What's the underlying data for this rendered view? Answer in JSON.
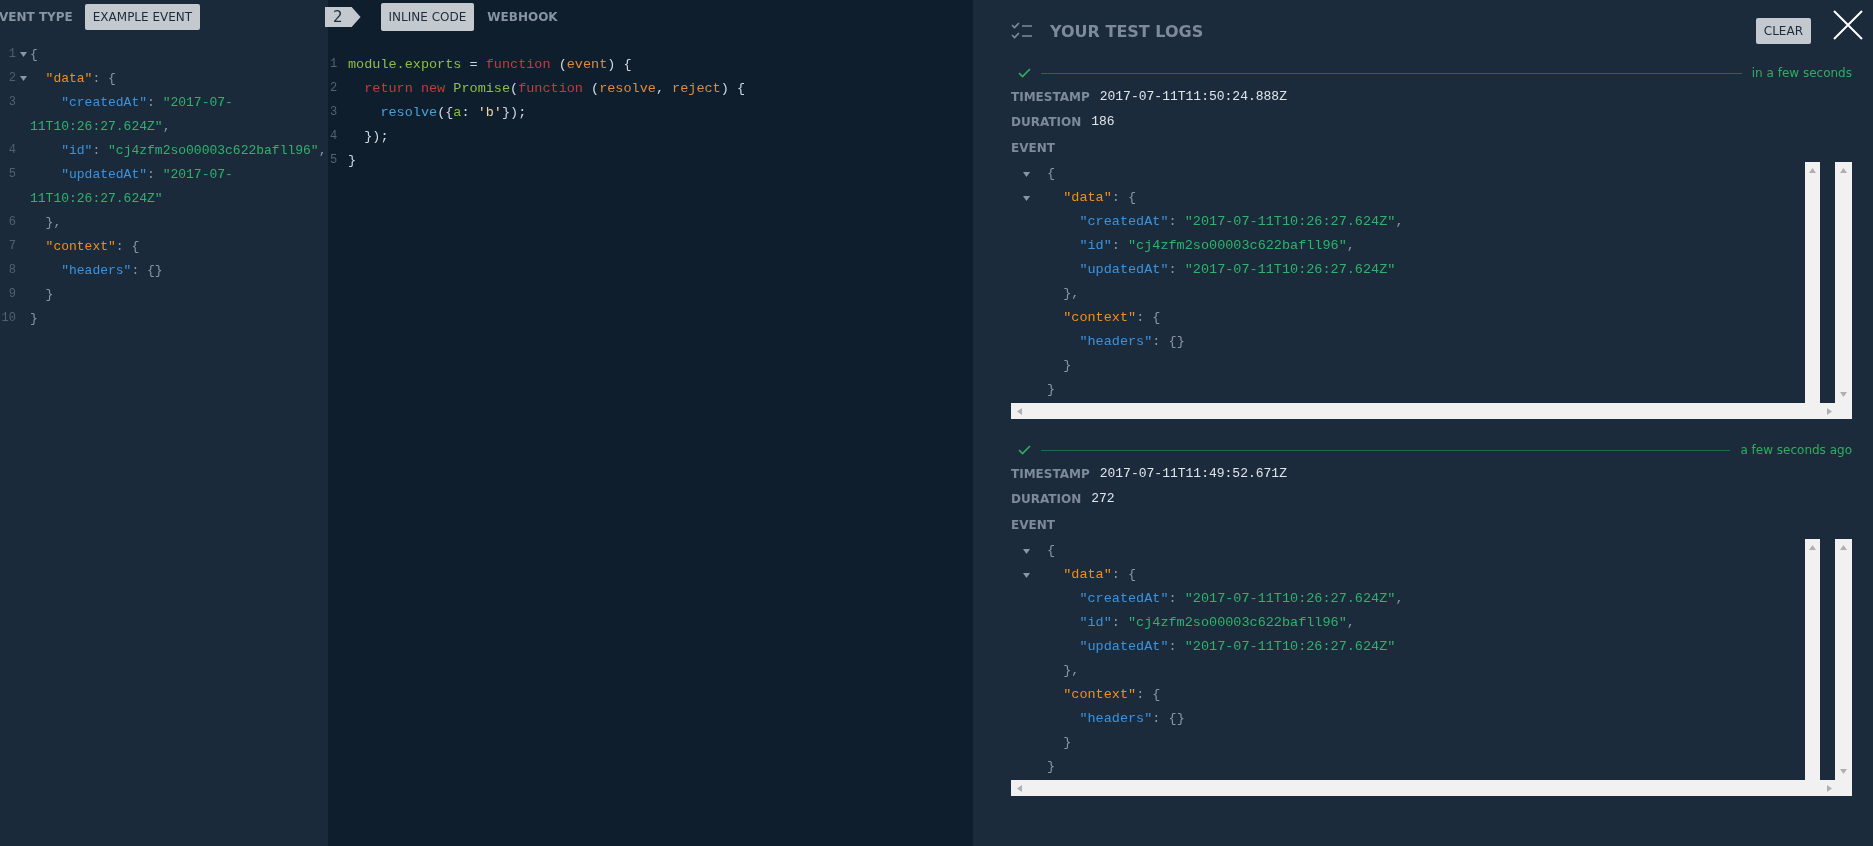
{
  "event_panel": {
    "label": "VENT TYPE",
    "button": "EXAMPLE EVENT",
    "lines": [
      {
        "n": "1",
        "fold": true,
        "tokens": [
          {
            "kind": "p",
            "text": "{"
          }
        ]
      },
      {
        "n": "2",
        "fold": true,
        "tokens": [
          {
            "kind": "prop",
            "text": "  \"data\""
          },
          {
            "kind": "p",
            "text": ": {"
          }
        ]
      },
      {
        "n": "3",
        "fold": false,
        "tokens": [
          {
            "kind": "key",
            "text": "    \"createdAt\""
          },
          {
            "kind": "p",
            "text": ": "
          },
          {
            "kind": "str",
            "text": "\"2017-07-"
          }
        ]
      },
      {
        "fold": false,
        "tokens": [
          {
            "kind": "str",
            "text": "11T10:26:27.624Z\""
          },
          {
            "kind": "p",
            "text": ","
          }
        ]
      },
      {
        "n": "4",
        "fold": false,
        "tokens": [
          {
            "kind": "key",
            "text": "    \"id\""
          },
          {
            "kind": "p",
            "text": ": "
          },
          {
            "kind": "str",
            "text": "\"cj4zfm2so00003c622bafll96\""
          },
          {
            "kind": "p",
            "text": ","
          }
        ]
      },
      {
        "n": "5",
        "fold": false,
        "tokens": [
          {
            "kind": "key",
            "text": "    \"updatedAt\""
          },
          {
            "kind": "p",
            "text": ": "
          },
          {
            "kind": "str",
            "text": "\"2017-07-"
          }
        ]
      },
      {
        "fold": false,
        "tokens": [
          {
            "kind": "str",
            "text": "11T10:26:27.624Z\""
          }
        ]
      },
      {
        "n": "6",
        "fold": false,
        "tokens": [
          {
            "kind": "p",
            "text": "  },"
          }
        ]
      },
      {
        "n": "7",
        "fold": false,
        "tokens": [
          {
            "kind": "prop",
            "text": "  \"context\""
          },
          {
            "kind": "p",
            "text": ": {"
          }
        ]
      },
      {
        "n": "8",
        "fold": false,
        "tokens": [
          {
            "kind": "key",
            "text": "    \"headers\""
          },
          {
            "kind": "p",
            "text": ": {}"
          }
        ]
      },
      {
        "n": "9",
        "fold": false,
        "tokens": [
          {
            "kind": "p",
            "text": "  }"
          }
        ]
      },
      {
        "n": "10",
        "fold": false,
        "tokens": [
          {
            "kind": "p",
            "text": "}"
          }
        ]
      }
    ]
  },
  "function_panel": {
    "step": "2",
    "tabs": [
      {
        "label": "INLINE CODE",
        "selected": true
      },
      {
        "label": "WEBHOOK",
        "selected": false
      }
    ],
    "lines": [
      {
        "n": "1",
        "tokens": [
          {
            "kind": "fn",
            "text": "module.exports"
          },
          {
            "kind": "op",
            "text": " = "
          },
          {
            "kind": "kw",
            "text": "function"
          },
          {
            "kind": "op",
            "text": " ("
          },
          {
            "kind": "param",
            "text": "event"
          },
          {
            "kind": "op",
            "text": ") {"
          }
        ]
      },
      {
        "n": "2",
        "tokens": [
          {
            "kind": "kw",
            "text": "  return new "
          },
          {
            "kind": "fn",
            "text": "Promise"
          },
          {
            "kind": "op",
            "text": "("
          },
          {
            "kind": "kw",
            "text": "function"
          },
          {
            "kind": "op",
            "text": " ("
          },
          {
            "kind": "param",
            "text": "resolve"
          },
          {
            "kind": "op",
            "text": ", "
          },
          {
            "kind": "param",
            "text": "reject"
          },
          {
            "kind": "op",
            "text": ") {"
          }
        ]
      },
      {
        "n": "3",
        "tokens": [
          {
            "kind": "call",
            "text": "    resolve"
          },
          {
            "kind": "op",
            "text": "({"
          },
          {
            "kind": "fn",
            "text": "a"
          },
          {
            "kind": "op",
            "text": ": "
          },
          {
            "kind": "str2",
            "text": "'b'"
          },
          {
            "kind": "op",
            "text": "});"
          }
        ]
      },
      {
        "n": "4",
        "tokens": [
          {
            "kind": "op",
            "text": "  });"
          }
        ]
      },
      {
        "n": "5",
        "tokens": [
          {
            "kind": "op",
            "text": "}"
          }
        ]
      }
    ]
  },
  "logs_panel": {
    "title": "YOUR TEST LOGS",
    "clear_button": "CLEAR",
    "logs": [
      {
        "passed": true,
        "when": "in a few seconds",
        "timestamp_label": "TIMESTAMP",
        "timestamp": "2017-07-11T11:50:24.888Z",
        "duration_label": "DURATION",
        "duration": "186",
        "event_label": "EVENT",
        "lines": [
          {
            "fold": true,
            "tokens": [
              {
                "kind": "p",
                "text": "{"
              }
            ]
          },
          {
            "fold": true,
            "tokens": [
              {
                "kind": "prop",
                "text": "  \"data\""
              },
              {
                "kind": "p",
                "text": ": {"
              }
            ]
          },
          {
            "fold": false,
            "tokens": [
              {
                "kind": "key",
                "text": "    \"createdAt\""
              },
              {
                "kind": "p",
                "text": ": "
              },
              {
                "kind": "str",
                "text": "\"2017-07-11T10:26:27.624Z\""
              },
              {
                "kind": "p",
                "text": ","
              }
            ]
          },
          {
            "fold": false,
            "tokens": [
              {
                "kind": "key",
                "text": "    \"id\""
              },
              {
                "kind": "p",
                "text": ": "
              },
              {
                "kind": "str",
                "text": "\"cj4zfm2so00003c622bafll96\""
              },
              {
                "kind": "p",
                "text": ","
              }
            ]
          },
          {
            "fold": false,
            "tokens": [
              {
                "kind": "key",
                "text": "    \"updatedAt\""
              },
              {
                "kind": "p",
                "text": ": "
              },
              {
                "kind": "str",
                "text": "\"2017-07-11T10:26:27.624Z\""
              }
            ]
          },
          {
            "fold": false,
            "tokens": [
              {
                "kind": "p",
                "text": "  },"
              }
            ]
          },
          {
            "fold": false,
            "tokens": [
              {
                "kind": "prop",
                "text": "  \"context\""
              },
              {
                "kind": "p",
                "text": ": {"
              }
            ]
          },
          {
            "fold": false,
            "tokens": [
              {
                "kind": "key",
                "text": "    \"headers\""
              },
              {
                "kind": "p",
                "text": ": {}"
              }
            ]
          },
          {
            "fold": false,
            "tokens": [
              {
                "kind": "p",
                "text": "  }"
              }
            ]
          },
          {
            "fold": false,
            "tokens": [
              {
                "kind": "p",
                "text": "}"
              }
            ]
          }
        ]
      },
      {
        "passed": true,
        "when": "a few seconds ago",
        "timestamp_label": "TIMESTAMP",
        "timestamp": "2017-07-11T11:49:52.671Z",
        "duration_label": "DURATION",
        "duration": "272",
        "event_label": "EVENT",
        "lines": [
          {
            "fold": true,
            "tokens": [
              {
                "kind": "p",
                "text": "{"
              }
            ]
          },
          {
            "fold": true,
            "tokens": [
              {
                "kind": "prop",
                "text": "  \"data\""
              },
              {
                "kind": "p",
                "text": ": {"
              }
            ]
          },
          {
            "fold": false,
            "tokens": [
              {
                "kind": "key",
                "text": "    \"createdAt\""
              },
              {
                "kind": "p",
                "text": ": "
              },
              {
                "kind": "str",
                "text": "\"2017-07-11T10:26:27.624Z\""
              },
              {
                "kind": "p",
                "text": ","
              }
            ]
          },
          {
            "fold": false,
            "tokens": [
              {
                "kind": "key",
                "text": "    \"id\""
              },
              {
                "kind": "p",
                "text": ": "
              },
              {
                "kind": "str",
                "text": "\"cj4zfm2so00003c622bafll96\""
              },
              {
                "kind": "p",
                "text": ","
              }
            ]
          },
          {
            "fold": false,
            "tokens": [
              {
                "kind": "key",
                "text": "    \"updatedAt\""
              },
              {
                "kind": "p",
                "text": ": "
              },
              {
                "kind": "str",
                "text": "\"2017-07-11T10:26:27.624Z\""
              }
            ]
          },
          {
            "fold": false,
            "tokens": [
              {
                "kind": "p",
                "text": "  },"
              }
            ]
          },
          {
            "fold": false,
            "tokens": [
              {
                "kind": "prop",
                "text": "  \"context\""
              },
              {
                "kind": "p",
                "text": ": {"
              }
            ]
          },
          {
            "fold": false,
            "tokens": [
              {
                "kind": "key",
                "text": "    \"headers\""
              },
              {
                "kind": "p",
                "text": ": {}"
              }
            ]
          },
          {
            "fold": false,
            "tokens": [
              {
                "kind": "p",
                "text": "  }"
              }
            ]
          },
          {
            "fold": false,
            "tokens": [
              {
                "kind": "p",
                "text": "}"
              }
            ]
          }
        ]
      }
    ]
  }
}
